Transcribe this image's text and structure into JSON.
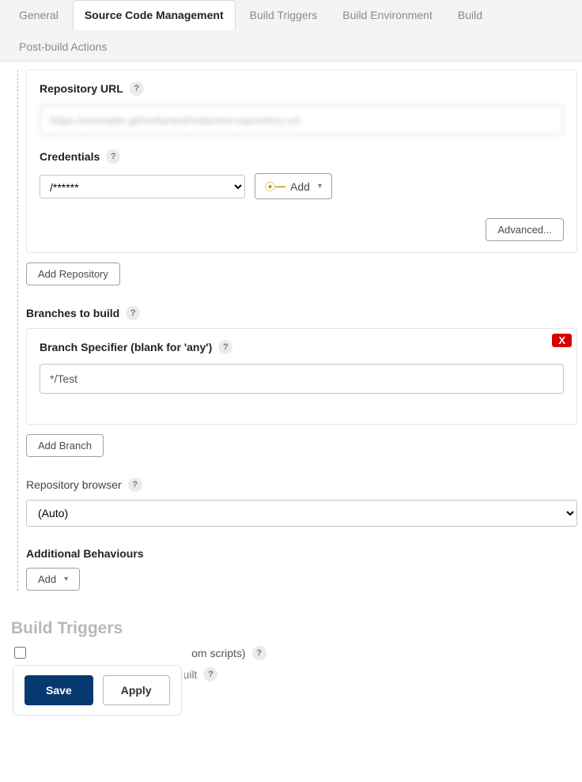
{
  "tabs": {
    "general": "General",
    "scm": "Source Code Management",
    "build_triggers": "Build Triggers",
    "build_env": "Build Environment",
    "build": "Build",
    "post_build": "Post-build Actions"
  },
  "repository": {
    "url_label": "Repository URL",
    "url_value": "https://example.git/redacted/redacted-repository-url",
    "credentials_label": "Credentials",
    "credentials_display": "      /******",
    "add_label": "Add",
    "advanced_label": "Advanced...",
    "add_repository_label": "Add Repository"
  },
  "branches": {
    "section_label": "Branches to build",
    "specifier_label": "Branch Specifier (blank for 'any')",
    "specifier_value": "*/Test",
    "delete_label": "X",
    "add_branch_label": "Add Branch"
  },
  "repo_browser": {
    "label": "Repository browser",
    "selected": "(Auto)"
  },
  "additional_behaviours": {
    "label": "Additional Behaviours",
    "add_label": "Add"
  },
  "build_triggers": {
    "heading": "Build Triggers",
    "trigger_remote": "Trigger builds remotely (e.g., from scripts)",
    "build_after": "Build after other projects are built"
  },
  "footer": {
    "save": "Save",
    "apply": "Apply"
  },
  "help_glyph": "?"
}
